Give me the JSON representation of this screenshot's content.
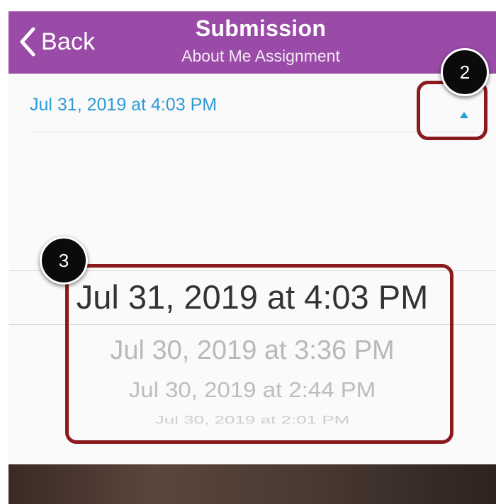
{
  "navbar": {
    "back_label": "Back",
    "title": "Submission",
    "subtitle": "About Me Assignment",
    "background_color": "#9a4ba8"
  },
  "submission_date": {
    "selected": "Jul 31, 2019 at 4:03 PM",
    "toggle_icon": "caret-up-icon",
    "accent_color": "#2d9bd6"
  },
  "picker": {
    "options": [
      "Jul 31, 2019 at 4:03 PM",
      "Jul 30, 2019 at 3:36 PM",
      "Jul 30, 2019 at 2:44 PM",
      "Jul 30, 2019 at 2:01 PM"
    ]
  },
  "callouts": {
    "step_2": "2",
    "step_3": "3",
    "highlight_color": "#8b1a1f"
  }
}
